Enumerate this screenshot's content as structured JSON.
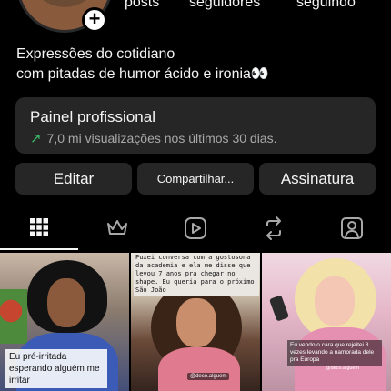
{
  "profile": {
    "stats": {
      "posts_label": "posts",
      "followers_label": "seguidores",
      "following_label": "seguindo"
    },
    "bio": {
      "line1": "Expressões do cotidiano",
      "line2": "com pitadas de humor ácido e ironia👀"
    }
  },
  "panel": {
    "title": "Painel profissional",
    "subtitle": "7,0 mi visualizações nos últimos 30 dias.",
    "trend_icon": "trend-up-icon",
    "trend_color": "#3cc46a"
  },
  "actions": {
    "edit_label": "Editar",
    "share_label": "Compartilhar...",
    "subscription_label": "Assinatura"
  },
  "tabs": [
    {
      "icon": "grid-icon",
      "active": true
    },
    {
      "icon": "crown-icon",
      "active": false
    },
    {
      "icon": "reels-icon",
      "active": false
    },
    {
      "icon": "repost-icon",
      "active": false
    },
    {
      "icon": "tagged-icon",
      "active": false
    }
  ],
  "posts": [
    {
      "caption": "Eu pré-irritada esperando alguém me irritar"
    },
    {
      "caption": "Puxei conversa com a gostosona da academia e ela me disse que levou 7 anos pra chegar no shape. Eu queria para o próximo São João",
      "tag": "@deco.alguem"
    },
    {
      "caption": "Eu vendo o cara que rejeitei 8 vezes levando a namorada dele pra Europa",
      "tag": "@deco.alguem"
    }
  ],
  "colors": {
    "background": "#000000",
    "card": "#262626",
    "text": "#f5f5f5",
    "muted": "#a8a8a8"
  }
}
